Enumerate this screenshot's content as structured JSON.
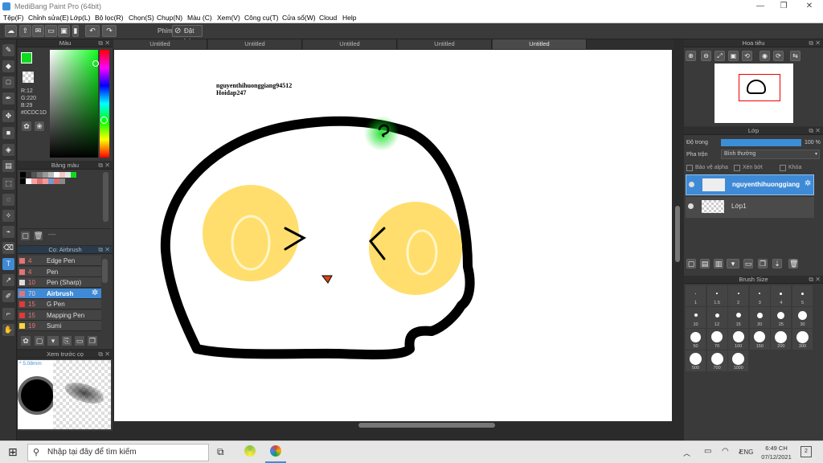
{
  "window": {
    "title": "MediBang Paint Pro (64bit)"
  },
  "menu": [
    "Tệp(F)",
    "Chỉnh sửa(E)",
    "Lớp(L)",
    "Bộ lọc(R)",
    "Chọn(S)",
    "Chụp(N)",
    "Màu (C)",
    "Xem(V)",
    "Công cụ(T)",
    "Cửa sổ(W)",
    "Cloud",
    "Help"
  ],
  "toolbar": {
    "phim_label": "Phím",
    "reset_label": "Đặt lại"
  },
  "color_panel": {
    "title": "Màu",
    "r": "R:12",
    "g": "G:220",
    "b": "B:29",
    "hex": "#0CDC1D",
    "fg_color": "#0cdc1d"
  },
  "palette_panel": {
    "title": "Bảng màu",
    "footer": "----",
    "swatches": [
      "#000000",
      "#333333",
      "#555555",
      "#777777",
      "#999999",
      "#bbbbbb",
      "#ffffff",
      "#f3c9c0",
      "#e8e8e8",
      "#0cdc1d",
      "#000000",
      "#ffffff",
      "#f4a3a3",
      "#e57373",
      "#ef9a9a",
      "#7b96c9",
      "#d36b6b",
      "#888888"
    ]
  },
  "brush_panel": {
    "title": "Cọ: Airbrush",
    "items": [
      {
        "size": "4",
        "name": "Edge Pen",
        "color": "#e57373",
        "active": false
      },
      {
        "size": "4",
        "name": "Pen",
        "color": "#e57373",
        "active": false
      },
      {
        "size": "10",
        "name": "Pen (Sharp)",
        "color": "#dddddd",
        "active": false
      },
      {
        "size": "70",
        "name": "Airbrush",
        "color": "#e57373",
        "active": true
      },
      {
        "size": "15",
        "name": "G Pen",
        "color": "#e53935",
        "active": false
      },
      {
        "size": "15",
        "name": "Mapping Pen",
        "color": "#e53935",
        "active": false
      },
      {
        "size": "19",
        "name": "Sumi",
        "color": "#fdd835",
        "active": false
      }
    ]
  },
  "preview_panel": {
    "title": "Xem trước cọ",
    "size": "* 5.08mm"
  },
  "tabs": [
    "Untitled",
    "Untitled",
    "Untitled",
    "Untitled",
    "Untitled"
  ],
  "canvas": {
    "line1": "nguyenthihuonggiang94512",
    "line2": "Hoidap247"
  },
  "navigator": {
    "title": "Hoa tiêu"
  },
  "layer_panel": {
    "title": "Lớp",
    "opacity_label": "Độ trong",
    "opacity_value": "100 %",
    "opacity": 100,
    "blend_label": "Pha trộn",
    "blend_value": "Bình thường",
    "protect_alpha": "Bảo vệ alpha",
    "clip": "Xén bớt",
    "lock": "Khóa",
    "layers": [
      {
        "name": "nguyenthihuonggiang",
        "active": true
      },
      {
        "name": "Lớp1",
        "active": false
      }
    ]
  },
  "brush_size": {
    "title": "Brush Size",
    "sizes": [
      "1",
      "1.5",
      "2",
      "3",
      "4",
      "5",
      "10",
      "12",
      "15",
      "20",
      "25",
      "30",
      "50",
      "70",
      "100",
      "150",
      "200",
      "300",
      "500",
      "700",
      "1000"
    ]
  },
  "taskbar": {
    "search_placeholder": "Nhập tại đây để tìm kiếm",
    "lang": "ENG",
    "time": "6:49 CH",
    "date": "07/12/2021",
    "notifications": "2"
  }
}
